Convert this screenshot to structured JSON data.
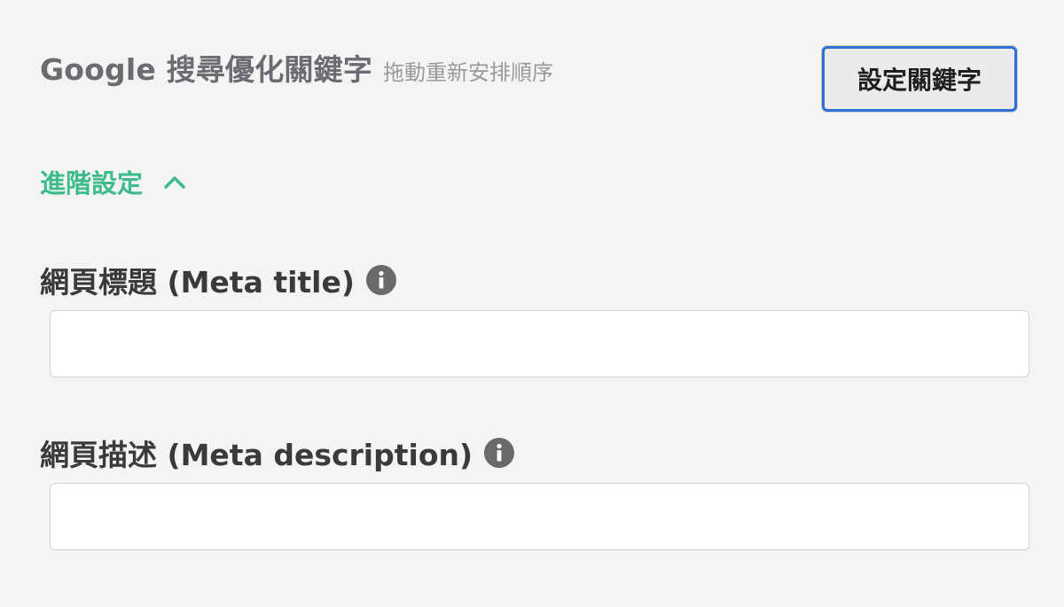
{
  "seo": {
    "title": "Google 搜尋優化關鍵字",
    "subtitle": "拖動重新安排順序",
    "set_keywords_label": "設定關鍵字"
  },
  "advanced": {
    "label": "進階設定",
    "expanded": true,
    "icon": "chevron-up-icon"
  },
  "meta_title": {
    "label": "網頁標題 (Meta title)",
    "value": "",
    "icon": "info-icon"
  },
  "meta_description": {
    "label": "網頁描述 (Meta description)",
    "value": "",
    "icon": "info-icon"
  },
  "colors": {
    "accent_green": "#3dbb8b",
    "button_focus_border": "#2f6fd6",
    "icon_gray": "#6a6a6a"
  }
}
